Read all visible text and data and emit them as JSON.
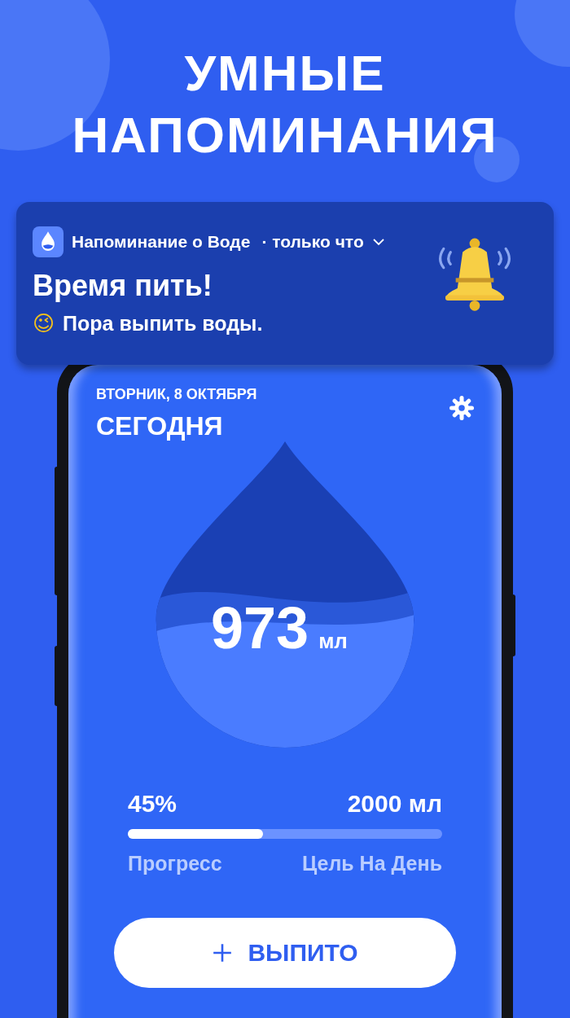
{
  "headline": [
    "УМНЫЕ",
    "НАПОМИНАНИЯ"
  ],
  "notification": {
    "app_name": "Напоминание о Воде",
    "time": "· только что",
    "title": "Время пить!",
    "emoji": "😉",
    "message": "Пора выпить воды."
  },
  "app": {
    "date": "ВТОРНИК, 8 ОКТЯБРЯ",
    "heading": "СЕГОДНЯ",
    "intake": {
      "amount": "973",
      "unit": "мл",
      "level": 0.38
    },
    "progress": {
      "percent": "45%",
      "goal": "2000 мл",
      "level": 0.43,
      "percent_label": "Прогресс",
      "goal_label": "Цель На День"
    },
    "drink_button": {
      "label": "ВЫПИТО"
    }
  }
}
